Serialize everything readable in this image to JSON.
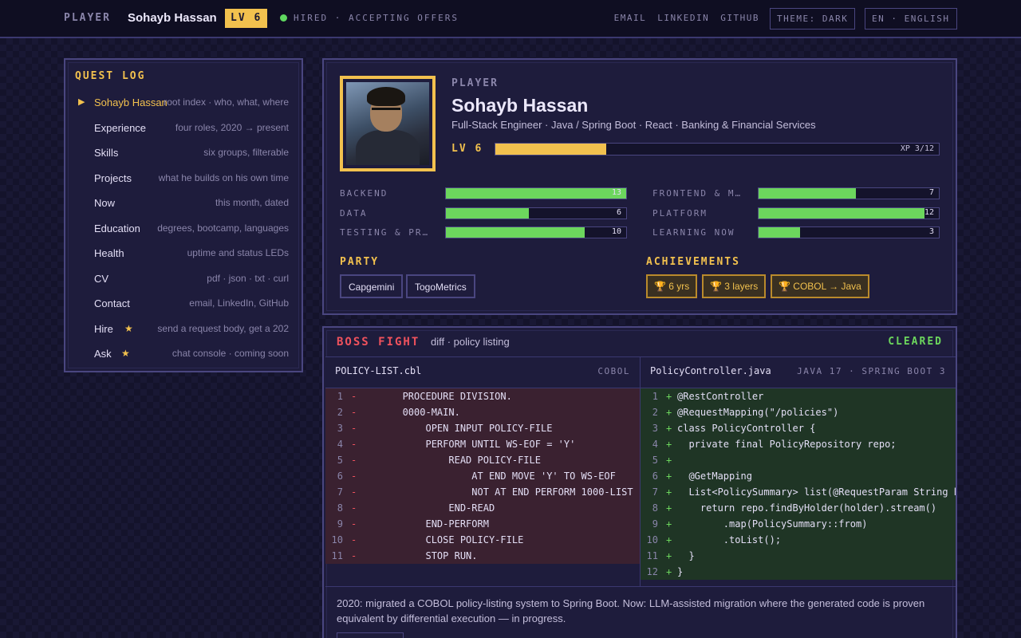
{
  "topbar": {
    "player_label": "PLAYER",
    "name": "Sohayb Hassan",
    "level": "LV 6",
    "status": "HIRED · ACCEPTING OFFERS",
    "links": [
      "EMAIL",
      "LINKEDIN",
      "GITHUB"
    ],
    "theme_button": "THEME: DARK",
    "lang_button": "EN · ENGLISH"
  },
  "quest_log": {
    "title": "QUEST LOG",
    "items": [
      {
        "label": "Sohayb Hassan",
        "desc": "root index · who, what, where",
        "active": true
      },
      {
        "label": "Experience",
        "desc": "four roles, 2020 → present"
      },
      {
        "label": "Skills",
        "desc": "six groups, filterable"
      },
      {
        "label": "Projects",
        "desc": "what he builds on his own time"
      },
      {
        "label": "Now",
        "desc": "this month, dated"
      },
      {
        "label": "Education",
        "desc": "degrees, bootcamp, languages"
      },
      {
        "label": "Health",
        "desc": "uptime and status LEDs"
      },
      {
        "label": "CV",
        "desc": "pdf · json · txt · curl"
      },
      {
        "label": "Contact",
        "desc": "email, LinkedIn, GitHub"
      },
      {
        "label": "Hire",
        "desc": "send a request body, get a 202",
        "star": "★"
      },
      {
        "label": "Ask",
        "desc": "chat console · coming soon",
        "star": "★"
      }
    ]
  },
  "player_card": {
    "player_label": "PLAYER",
    "name": "Sohayb Hassan",
    "subtitle": "Full-Stack Engineer · Java / Spring Boot · React · Banking & Financial Services",
    "level": "LV 6",
    "xp_label": "XP 3/12",
    "xp_fraction": 0.25,
    "skills": [
      {
        "label": "BACKEND",
        "value": "13",
        "fill": 1.0
      },
      {
        "label": "FRONTEND & MOBILE",
        "value": "7",
        "fill": 0.54
      },
      {
        "label": "DATA",
        "value": "6",
        "fill": 0.46
      },
      {
        "label": "PLATFORM",
        "value": "12",
        "fill": 0.92
      },
      {
        "label": "TESTING & PRACTICES",
        "value": "10",
        "fill": 0.77
      },
      {
        "label": "LEARNING NOW",
        "value": "3",
        "fill": 0.23
      }
    ],
    "party_title": "PARTY",
    "party": [
      "Capgemini",
      "TogoMetrics"
    ],
    "achievements_title": "ACHIEVEMENTS",
    "achievements": [
      "🏆 6 yrs",
      "🏆 3 layers",
      "🏆 COBOL → Java"
    ]
  },
  "boss_fight": {
    "title": "BOSS FIGHT",
    "subtitle": "diff · policy listing",
    "status": "CLEARED",
    "old_file": "POLICY-LIST.cbl",
    "old_lang": "COBOL",
    "new_file": "PolicyController.java",
    "new_lang": "JAVA 17 · SPRING BOOT 3",
    "old_lines": [
      "       PROCEDURE DIVISION.",
      "       0000-MAIN.",
      "           OPEN INPUT POLICY-FILE",
      "           PERFORM UNTIL WS-EOF = 'Y'",
      "               READ POLICY-FILE",
      "                   AT END MOVE 'Y' TO WS-EOF",
      "                   NOT AT END PERFORM 1000-LIST",
      "               END-READ",
      "           END-PERFORM",
      "           CLOSE POLICY-FILE",
      "           STOP RUN."
    ],
    "new_lines": [
      "@RestController",
      "@RequestMapping(\"/policies\")",
      "class PolicyController {",
      "  private final PolicyRepository repo;",
      "",
      "  @GetMapping",
      "  List<PolicySummary> list(@RequestParam String holder) {",
      "    return repo.findByHolder(holder).stream()",
      "        .map(PolicySummary::from)",
      "        .toList();",
      "  }",
      "}"
    ],
    "note": "2020: migrated a COBOL policy-listing system to Spring Boot. Now: LLM-assisted migration where the generated code is proven equivalent by differential execution — in progress."
  },
  "colors": {
    "accent": "#f2c14e",
    "success": "#6cd65d",
    "danger": "#f0525d",
    "background": "#14132b",
    "panel": "#1e1c3c"
  }
}
